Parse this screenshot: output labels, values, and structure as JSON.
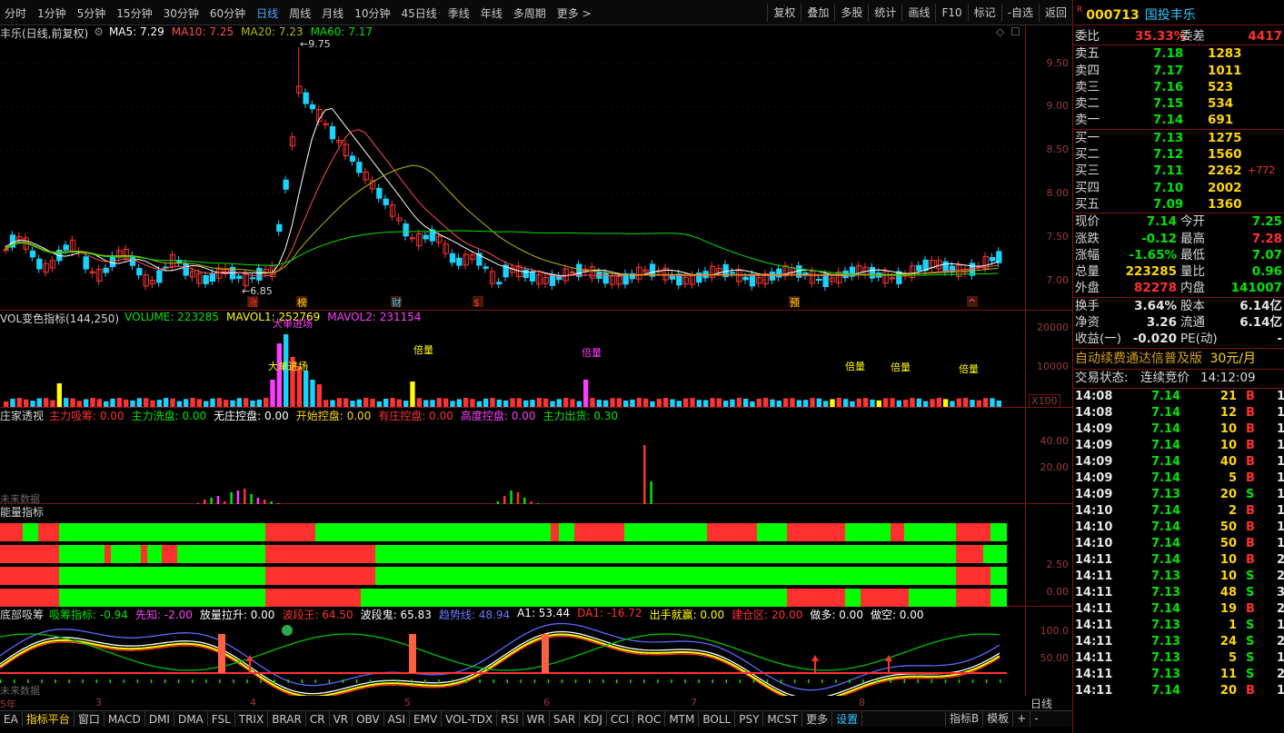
{
  "toolbar": {
    "periods": [
      "分时",
      "1分钟",
      "5分钟",
      "15分钟",
      "30分钟",
      "60分钟",
      "日线",
      "周线",
      "月线",
      "10分钟",
      "45日线",
      "季线",
      "年线",
      "多周期",
      "更多 >"
    ],
    "active_period": "日线",
    "tools": [
      "复权",
      "叠加",
      "多股",
      "统计",
      "画线",
      "F10",
      "标记",
      "-自选",
      "返回"
    ]
  },
  "kline_panel": {
    "title": "丰乐(日线,前复权)",
    "ma": [
      "MA5: 7.29",
      "MA10: 7.25",
      "MA20: 7.23",
      "MA60: 7.17"
    ],
    "ma_colors": [
      "#ffffff",
      "#ff4d4d",
      "#b8b800",
      "#00e400"
    ],
    "y_ticks": [
      "9.50",
      "9.00",
      "8.50",
      "8.00",
      "7.50",
      "7.00"
    ],
    "high_label": "9.75",
    "low_label": "6.85",
    "markers": [
      "涨",
      "榜",
      "财",
      "$",
      "预",
      "^"
    ]
  },
  "vol_panel": {
    "title": "VOL变色指标(144,250)",
    "legend": [
      "VOLUME: 223285",
      "MAVOL1: 252769",
      "MAVOL2: 231154"
    ],
    "legend_colors": [
      "#00e400",
      "#ffff00",
      "#ff3cff"
    ],
    "y_ticks": [
      "20000",
      "10000"
    ],
    "unit": "X100",
    "annotations": [
      "大单进场",
      "倍量",
      "倍量",
      "大单进场",
      "倍量",
      "倍量",
      "倍量"
    ]
  },
  "dealer_panel": {
    "title": "庄家透视",
    "legend": [
      "主力吸筹: 0.00",
      "主力洗盘: 0.00",
      "无庄控盘: 0.00",
      "开始控盘: 0.00",
      "有庄控盘: 0.00",
      "高度控盘: 0.00",
      "主力出货: 0.30"
    ],
    "legend_colors": [
      "#ff3030",
      "#00e400",
      "#ffffff",
      "#ffd700",
      "#ff3030",
      "#ff3cff",
      "#00e400"
    ],
    "y_ticks": [
      "40.00",
      "20.00"
    ],
    "note": "未来数据"
  },
  "energy_panel": {
    "title": "能量指标",
    "y_ticks": [
      "2.50",
      "0.00"
    ]
  },
  "bottom_panel": {
    "title": "底部吸筹",
    "legend": [
      "吸筹指标: -0.94",
      "先知: -2.00",
      "放量拉升: 0.00",
      "波段王: 64.50",
      "波段鬼: 65.83",
      "趋势线: 48.94",
      "A1: 53.44",
      "DA1: -16.72",
      "出手就赢: 0.00",
      "建仓区: 20.00",
      "做多: 0.00",
      "做空: 0.00"
    ],
    "legend_colors": [
      "#00e400",
      "#ff3cff",
      "#ffffff",
      "#ff3030",
      "#ffffff",
      "#6a7bff",
      "#ffffff",
      "#ff3030",
      "#ffff00",
      "#ff3030",
      "#ffffff",
      "#ffffff"
    ],
    "y_ticks": [
      "100.0",
      "50.00"
    ],
    "note": "未来数据"
  },
  "x_axis": {
    "labels": [
      "5年",
      "3",
      "4",
      "5",
      "6",
      "7",
      "8"
    ],
    "period": "日线"
  },
  "tabs": [
    "EA",
    "指标平台",
    "窗口",
    "MACD",
    "DMI",
    "DMA",
    "FSL",
    "TRIX",
    "BRAR",
    "CR",
    "VR",
    "OBV",
    "ASI",
    "EMV",
    "VOL-TDX",
    "RSI",
    "WR",
    "SAR",
    "KDJ",
    "CCI",
    "ROC",
    "MTM",
    "BOLL",
    "PSY",
    "MCST",
    "更多",
    "设置"
  ],
  "tabs_right": [
    "指标B",
    "模板",
    "+",
    "-"
  ],
  "quote": {
    "r_badge": "R",
    "code": "000713",
    "name": "国投丰乐",
    "weibi_label": "委比",
    "weibi": "35.33%",
    "weicha_label": "委差",
    "weicha": "4417",
    "sell": [
      {
        "label": "卖五",
        "price": "7.18",
        "vol": "1283"
      },
      {
        "label": "卖四",
        "price": "7.17",
        "vol": "1011"
      },
      {
        "label": "卖三",
        "price": "7.16",
        "vol": "523"
      },
      {
        "label": "卖二",
        "price": "7.15",
        "vol": "534"
      },
      {
        "label": "卖一",
        "price": "7.14",
        "vol": "691"
      }
    ],
    "buy": [
      {
        "label": "买一",
        "price": "7.13",
        "vol": "1275",
        "extra": ""
      },
      {
        "label": "买二",
        "price": "7.12",
        "vol": "1560",
        "extra": ""
      },
      {
        "label": "买三",
        "price": "7.11",
        "vol": "2262",
        "extra": "+772"
      },
      {
        "label": "买四",
        "price": "7.10",
        "vol": "2002",
        "extra": ""
      },
      {
        "label": "买五",
        "price": "7.09",
        "vol": "1360",
        "extra": ""
      }
    ],
    "stats1": [
      {
        "l1": "现价",
        "v1": "7.14",
        "c1": "green",
        "l2": "今开",
        "v2": "7.25",
        "c2": "green"
      },
      {
        "l1": "涨跌",
        "v1": "-0.12",
        "c1": "green",
        "l2": "最高",
        "v2": "7.28",
        "c2": "red"
      },
      {
        "l1": "涨幅",
        "v1": "-1.65%",
        "c1": "green",
        "l2": "最低",
        "v2": "7.07",
        "c2": "green"
      },
      {
        "l1": "总量",
        "v1": "223285",
        "c1": "yellow",
        "l2": "量比",
        "v2": "0.96",
        "c2": "green"
      },
      {
        "l1": "外盘",
        "v1": "82278",
        "c1": "red",
        "l2": "内盘",
        "v2": "141007",
        "c2": "green"
      }
    ],
    "stats2": [
      {
        "l1": "换手",
        "v1": "3.64%",
        "l2": "股本",
        "v2": "6.14亿"
      },
      {
        "l1": "净资",
        "v1": "3.26",
        "l2": "流通",
        "v2": "6.14亿"
      },
      {
        "l1": "收益(一)",
        "v1": "-0.020",
        "l2": "PE(动)",
        "v2": "-"
      }
    ],
    "ad": "自动续费通达信普及版",
    "ad_price": "30元/月",
    "status_label": "交易状态:",
    "status": "连续竞价",
    "status_time": "14:12:09",
    "trades": [
      {
        "t": "14:08",
        "p": "7.14",
        "v": "21",
        "d": "B",
        "n": "1"
      },
      {
        "t": "14:08",
        "p": "7.14",
        "v": "12",
        "d": "B",
        "n": "1"
      },
      {
        "t": "14:09",
        "p": "7.14",
        "v": "10",
        "d": "B",
        "n": "1"
      },
      {
        "t": "14:09",
        "p": "7.14",
        "v": "10",
        "d": "B",
        "n": "1"
      },
      {
        "t": "14:09",
        "p": "7.14",
        "v": "40",
        "d": "B",
        "n": "1"
      },
      {
        "t": "14:09",
        "p": "7.14",
        "v": "5",
        "d": "B",
        "n": "1"
      },
      {
        "t": "14:09",
        "p": "7.13",
        "v": "20",
        "d": "S",
        "n": "1"
      },
      {
        "t": "14:10",
        "p": "7.14",
        "v": "2",
        "d": "B",
        "n": "1"
      },
      {
        "t": "14:10",
        "p": "7.14",
        "v": "50",
        "d": "B",
        "n": "1"
      },
      {
        "t": "14:10",
        "p": "7.14",
        "v": "50",
        "d": "B",
        "n": "1"
      },
      {
        "t": "14:11",
        "p": "7.14",
        "v": "10",
        "d": "B",
        "n": "2"
      },
      {
        "t": "14:11",
        "p": "7.13",
        "v": "10",
        "d": "S",
        "n": "2"
      },
      {
        "t": "14:11",
        "p": "7.13",
        "v": "48",
        "d": "S",
        "n": "3"
      },
      {
        "t": "14:11",
        "p": "7.14",
        "v": "19",
        "d": "B",
        "n": "2"
      },
      {
        "t": "14:11",
        "p": "7.13",
        "v": "1",
        "d": "S",
        "n": "1"
      },
      {
        "t": "14:11",
        "p": "7.13",
        "v": "24",
        "d": "S",
        "n": "2"
      },
      {
        "t": "14:11",
        "p": "7.13",
        "v": "5",
        "d": "S",
        "n": "1"
      },
      {
        "t": "14:11",
        "p": "7.13",
        "v": "11",
        "d": "S",
        "n": "2"
      },
      {
        "t": "14:11",
        "p": "7.14",
        "v": "20",
        "d": "B",
        "n": "1"
      }
    ]
  }
}
